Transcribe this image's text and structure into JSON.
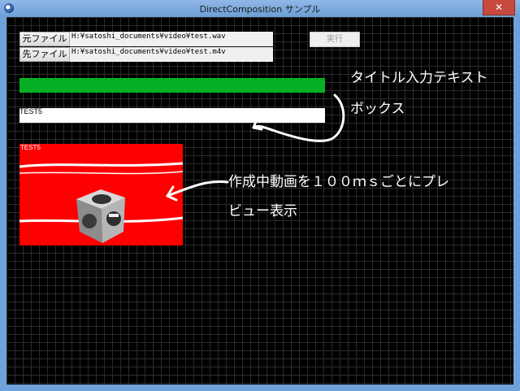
{
  "window": {
    "title": "DirectComposition サンプル",
    "close_glyph": "✕"
  },
  "files": [
    {
      "button_label": "元ファイル",
      "path": "H:¥satoshi_documents¥video¥test.wav"
    },
    {
      "button_label": "先ファイル",
      "path": "H:¥satoshi_documents¥video¥test.m4v"
    }
  ],
  "run_button": {
    "label": "実行"
  },
  "progress": {
    "value": 1.0
  },
  "text_input": {
    "value": "TEST5"
  },
  "preview": {
    "label": "TEST5"
  },
  "annotations": {
    "textbox_line1": "タイトル入力テキスト",
    "textbox_line2": "ボックス",
    "preview_line1": "作成中動画を１００ｍｓごとにプレ",
    "preview_line2": "ビュー表示"
  },
  "colors": {
    "titlebar": "#6c9ed6",
    "progress_fill": "#06b025",
    "preview_bg": "#ff0000",
    "close_button": "#c74a3f"
  }
}
